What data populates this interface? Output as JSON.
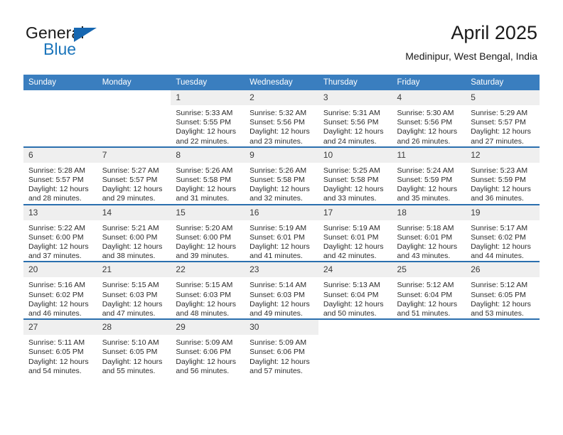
{
  "brand": {
    "name_part1": "General",
    "name_part2": "Blue",
    "logo_icon": "triangle-flag-icon",
    "accent_color": "#1667b1"
  },
  "header": {
    "title": "April 2025",
    "subtitle": "Medinipur, West Bengal, India"
  },
  "theme": {
    "header_row_bg": "#3a7ebf",
    "row_divider": "#2b6fae",
    "daynum_bg": "#efefef",
    "text_color": "#2b2b2b"
  },
  "weekdays": [
    "Sunday",
    "Monday",
    "Tuesday",
    "Wednesday",
    "Thursday",
    "Friday",
    "Saturday"
  ],
  "weeks": [
    [
      {
        "day": "",
        "empty": true,
        "sunrise": "",
        "sunset": "",
        "daylight1": "",
        "daylight2": ""
      },
      {
        "day": "",
        "empty": true,
        "sunrise": "",
        "sunset": "",
        "daylight1": "",
        "daylight2": ""
      },
      {
        "day": "1",
        "sunrise": "Sunrise: 5:33 AM",
        "sunset": "Sunset: 5:55 PM",
        "daylight1": "Daylight: 12 hours",
        "daylight2": "and 22 minutes."
      },
      {
        "day": "2",
        "sunrise": "Sunrise: 5:32 AM",
        "sunset": "Sunset: 5:56 PM",
        "daylight1": "Daylight: 12 hours",
        "daylight2": "and 23 minutes."
      },
      {
        "day": "3",
        "sunrise": "Sunrise: 5:31 AM",
        "sunset": "Sunset: 5:56 PM",
        "daylight1": "Daylight: 12 hours",
        "daylight2": "and 24 minutes."
      },
      {
        "day": "4",
        "sunrise": "Sunrise: 5:30 AM",
        "sunset": "Sunset: 5:56 PM",
        "daylight1": "Daylight: 12 hours",
        "daylight2": "and 26 minutes."
      },
      {
        "day": "5",
        "sunrise": "Sunrise: 5:29 AM",
        "sunset": "Sunset: 5:57 PM",
        "daylight1": "Daylight: 12 hours",
        "daylight2": "and 27 minutes."
      }
    ],
    [
      {
        "day": "6",
        "sunrise": "Sunrise: 5:28 AM",
        "sunset": "Sunset: 5:57 PM",
        "daylight1": "Daylight: 12 hours",
        "daylight2": "and 28 minutes."
      },
      {
        "day": "7",
        "sunrise": "Sunrise: 5:27 AM",
        "sunset": "Sunset: 5:57 PM",
        "daylight1": "Daylight: 12 hours",
        "daylight2": "and 29 minutes."
      },
      {
        "day": "8",
        "sunrise": "Sunrise: 5:26 AM",
        "sunset": "Sunset: 5:58 PM",
        "daylight1": "Daylight: 12 hours",
        "daylight2": "and 31 minutes."
      },
      {
        "day": "9",
        "sunrise": "Sunrise: 5:26 AM",
        "sunset": "Sunset: 5:58 PM",
        "daylight1": "Daylight: 12 hours",
        "daylight2": "and 32 minutes."
      },
      {
        "day": "10",
        "sunrise": "Sunrise: 5:25 AM",
        "sunset": "Sunset: 5:58 PM",
        "daylight1": "Daylight: 12 hours",
        "daylight2": "and 33 minutes."
      },
      {
        "day": "11",
        "sunrise": "Sunrise: 5:24 AM",
        "sunset": "Sunset: 5:59 PM",
        "daylight1": "Daylight: 12 hours",
        "daylight2": "and 35 minutes."
      },
      {
        "day": "12",
        "sunrise": "Sunrise: 5:23 AM",
        "sunset": "Sunset: 5:59 PM",
        "daylight1": "Daylight: 12 hours",
        "daylight2": "and 36 minutes."
      }
    ],
    [
      {
        "day": "13",
        "sunrise": "Sunrise: 5:22 AM",
        "sunset": "Sunset: 6:00 PM",
        "daylight1": "Daylight: 12 hours",
        "daylight2": "and 37 minutes."
      },
      {
        "day": "14",
        "sunrise": "Sunrise: 5:21 AM",
        "sunset": "Sunset: 6:00 PM",
        "daylight1": "Daylight: 12 hours",
        "daylight2": "and 38 minutes."
      },
      {
        "day": "15",
        "sunrise": "Sunrise: 5:20 AM",
        "sunset": "Sunset: 6:00 PM",
        "daylight1": "Daylight: 12 hours",
        "daylight2": "and 39 minutes."
      },
      {
        "day": "16",
        "sunrise": "Sunrise: 5:19 AM",
        "sunset": "Sunset: 6:01 PM",
        "daylight1": "Daylight: 12 hours",
        "daylight2": "and 41 minutes."
      },
      {
        "day": "17",
        "sunrise": "Sunrise: 5:19 AM",
        "sunset": "Sunset: 6:01 PM",
        "daylight1": "Daylight: 12 hours",
        "daylight2": "and 42 minutes."
      },
      {
        "day": "18",
        "sunrise": "Sunrise: 5:18 AM",
        "sunset": "Sunset: 6:01 PM",
        "daylight1": "Daylight: 12 hours",
        "daylight2": "and 43 minutes."
      },
      {
        "day": "19",
        "sunrise": "Sunrise: 5:17 AM",
        "sunset": "Sunset: 6:02 PM",
        "daylight1": "Daylight: 12 hours",
        "daylight2": "and 44 minutes."
      }
    ],
    [
      {
        "day": "20",
        "sunrise": "Sunrise: 5:16 AM",
        "sunset": "Sunset: 6:02 PM",
        "daylight1": "Daylight: 12 hours",
        "daylight2": "and 46 minutes."
      },
      {
        "day": "21",
        "sunrise": "Sunrise: 5:15 AM",
        "sunset": "Sunset: 6:03 PM",
        "daylight1": "Daylight: 12 hours",
        "daylight2": "and 47 minutes."
      },
      {
        "day": "22",
        "sunrise": "Sunrise: 5:15 AM",
        "sunset": "Sunset: 6:03 PM",
        "daylight1": "Daylight: 12 hours",
        "daylight2": "and 48 minutes."
      },
      {
        "day": "23",
        "sunrise": "Sunrise: 5:14 AM",
        "sunset": "Sunset: 6:03 PM",
        "daylight1": "Daylight: 12 hours",
        "daylight2": "and 49 minutes."
      },
      {
        "day": "24",
        "sunrise": "Sunrise: 5:13 AM",
        "sunset": "Sunset: 6:04 PM",
        "daylight1": "Daylight: 12 hours",
        "daylight2": "and 50 minutes."
      },
      {
        "day": "25",
        "sunrise": "Sunrise: 5:12 AM",
        "sunset": "Sunset: 6:04 PM",
        "daylight1": "Daylight: 12 hours",
        "daylight2": "and 51 minutes."
      },
      {
        "day": "26",
        "sunrise": "Sunrise: 5:12 AM",
        "sunset": "Sunset: 6:05 PM",
        "daylight1": "Daylight: 12 hours",
        "daylight2": "and 53 minutes."
      }
    ],
    [
      {
        "day": "27",
        "sunrise": "Sunrise: 5:11 AM",
        "sunset": "Sunset: 6:05 PM",
        "daylight1": "Daylight: 12 hours",
        "daylight2": "and 54 minutes."
      },
      {
        "day": "28",
        "sunrise": "Sunrise: 5:10 AM",
        "sunset": "Sunset: 6:05 PM",
        "daylight1": "Daylight: 12 hours",
        "daylight2": "and 55 minutes."
      },
      {
        "day": "29",
        "sunrise": "Sunrise: 5:09 AM",
        "sunset": "Sunset: 6:06 PM",
        "daylight1": "Daylight: 12 hours",
        "daylight2": "and 56 minutes."
      },
      {
        "day": "30",
        "sunrise": "Sunrise: 5:09 AM",
        "sunset": "Sunset: 6:06 PM",
        "daylight1": "Daylight: 12 hours",
        "daylight2": "and 57 minutes."
      },
      {
        "day": "",
        "empty": true,
        "sunrise": "",
        "sunset": "",
        "daylight1": "",
        "daylight2": ""
      },
      {
        "day": "",
        "empty": true,
        "sunrise": "",
        "sunset": "",
        "daylight1": "",
        "daylight2": ""
      },
      {
        "day": "",
        "empty": true,
        "sunrise": "",
        "sunset": "",
        "daylight1": "",
        "daylight2": ""
      }
    ]
  ]
}
